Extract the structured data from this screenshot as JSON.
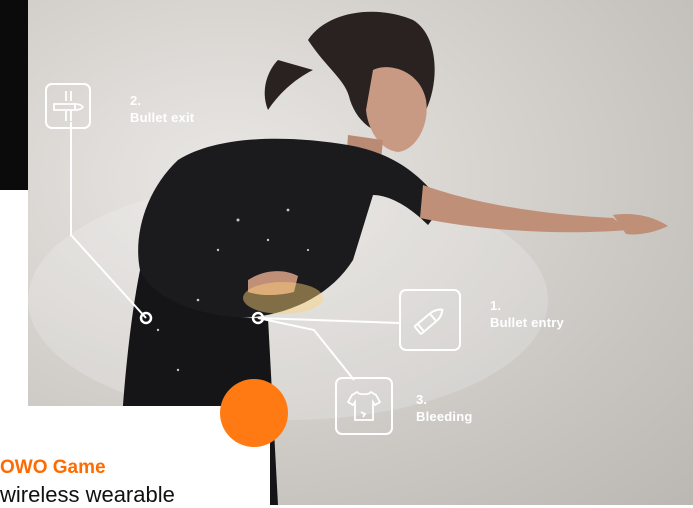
{
  "callouts": [
    {
      "number": "1.",
      "label": "Bullet entry",
      "icon": "bullet-icon"
    },
    {
      "number": "2.",
      "label": "Bullet exit",
      "icon": "bullet-exit-icon"
    },
    {
      "number": "3.",
      "label": "Bleeding",
      "icon": "shirt-icon"
    }
  ],
  "card": {
    "title": "OWO Game",
    "text": "wireless wearable"
  },
  "colors": {
    "accent": "#ff7a12",
    "title": "#ff6b00",
    "outline": "#ffffff",
    "topband": "#0b0b0b"
  }
}
